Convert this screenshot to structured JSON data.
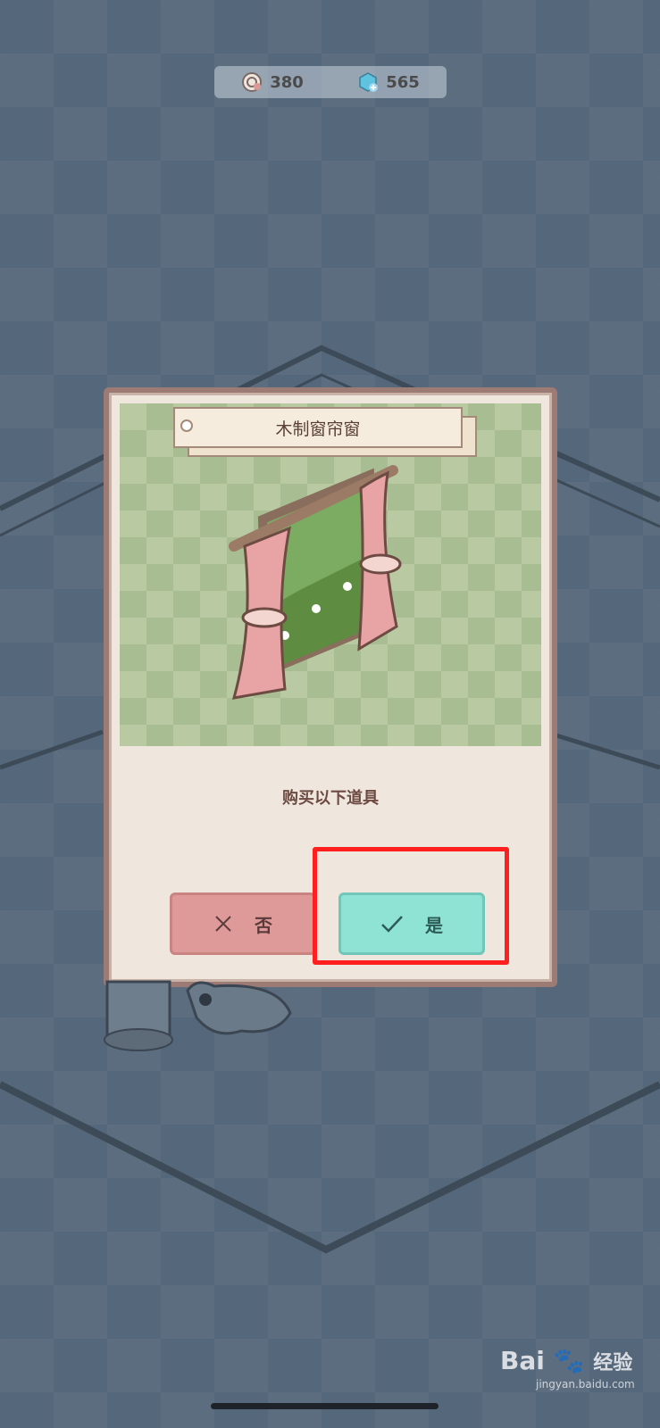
{
  "currency": {
    "coins": "380",
    "gems": "565",
    "coin_icon": "coin-icon",
    "gem_icon": "gem-plus-icon"
  },
  "dialog": {
    "item_name": "木制窗帘窗",
    "message": "购买以下道具",
    "no_label": "否",
    "yes_label": "是",
    "colors": {
      "no_button": "#dd9a98",
      "yes_button": "#8fe3d5",
      "highlight": "#ff1f1f"
    }
  },
  "watermark": {
    "brand": "Bai",
    "brand_suffix": "经验",
    "url": "jingyan.baidu.com"
  }
}
